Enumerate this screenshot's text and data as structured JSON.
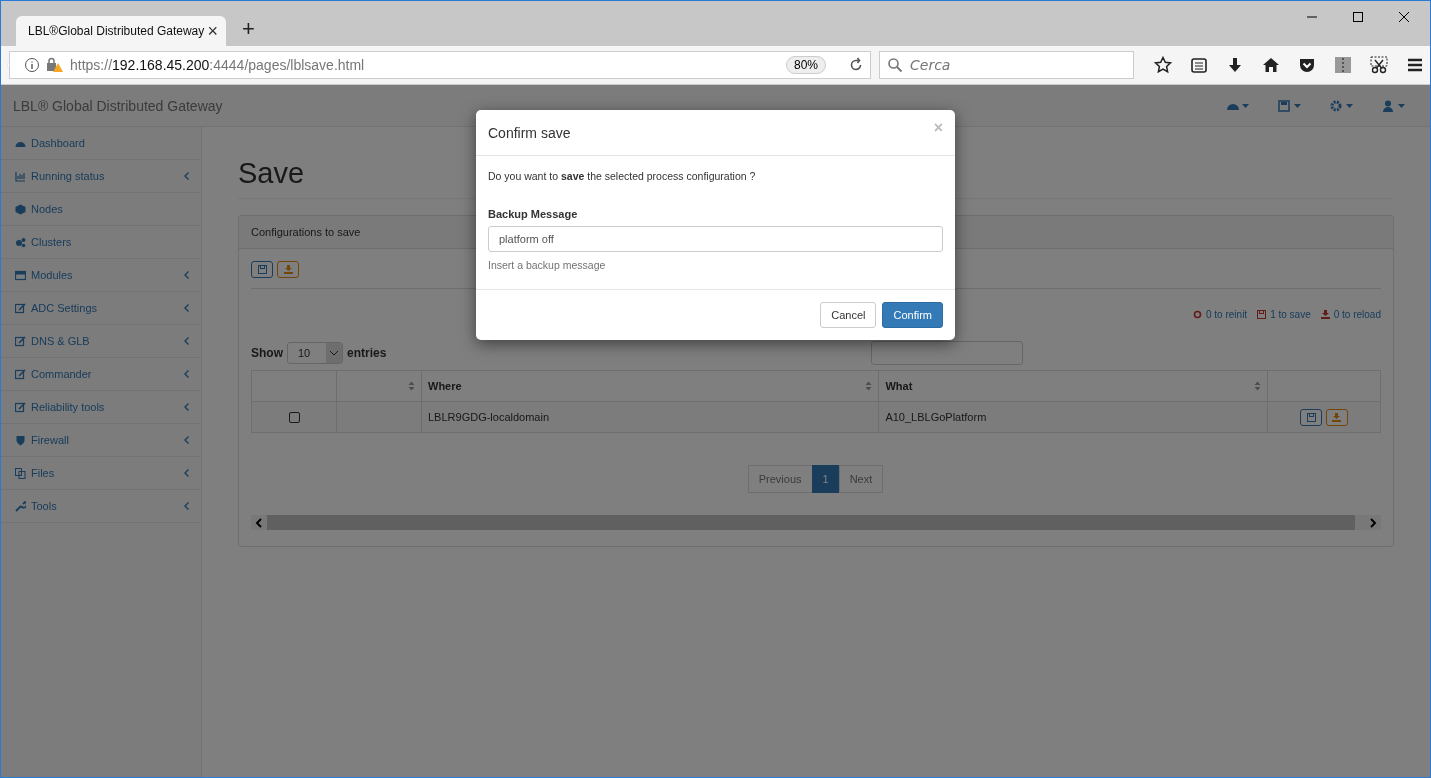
{
  "browser": {
    "tab": {
      "title": "LBL®Global Distributed Gateway",
      "close": "×",
      "new_tab": "+"
    },
    "address": {
      "scheme": "https://",
      "host": "192.168.45.200",
      "path": ":4444/pages/lblsave.html",
      "zoom": "80%"
    },
    "search": {
      "placeholder": "Cerca"
    }
  },
  "navbar": {
    "brand": "LBL® Global Distributed Gateway"
  },
  "sidebar": {
    "items": [
      {
        "label": "Dashboard",
        "has_submenu": false
      },
      {
        "label": "Running status",
        "has_submenu": true
      },
      {
        "label": "Nodes",
        "has_submenu": false
      },
      {
        "label": "Clusters",
        "has_submenu": false
      },
      {
        "label": "Modules",
        "has_submenu": true
      },
      {
        "label": "ADC Settings",
        "has_submenu": true
      },
      {
        "label": "DNS & GLB",
        "has_submenu": true
      },
      {
        "label": "Commander",
        "has_submenu": true
      },
      {
        "label": "Reliability tools",
        "has_submenu": true
      },
      {
        "label": "Firewall",
        "has_submenu": true
      },
      {
        "label": "Files",
        "has_submenu": true
      },
      {
        "label": "Tools",
        "has_submenu": true
      }
    ]
  },
  "page": {
    "title": "Save",
    "panel": {
      "heading": "Configurations to save",
      "counters": [
        {
          "kind": "reinit",
          "text": "0 to reinit"
        },
        {
          "kind": "save",
          "text": "1 to save"
        },
        {
          "kind": "reload",
          "text": "0 to reload"
        }
      ],
      "length": {
        "before": "Show",
        "value": "10",
        "after": "entries"
      },
      "table": {
        "columns": [
          "",
          "",
          "Where",
          "What",
          ""
        ],
        "rows": [
          {
            "checked": false,
            "where": "LBLR9GDG-localdomain",
            "what": "A10_LBLGoPlatform"
          }
        ]
      },
      "pagination": [
        {
          "label": "Previous",
          "selected": false
        },
        {
          "label": "1",
          "selected": true
        },
        {
          "label": "Next",
          "selected": false
        }
      ]
    }
  },
  "modal": {
    "title": "Confirm save",
    "close": "×",
    "message": "Do you want to **save** the selected process configuration ?",
    "field_label": "Backup Message",
    "field_value": "platform off",
    "help": "Insert a backup message",
    "buttons": [
      {
        "label": "Cancel",
        "kind": "default"
      },
      {
        "label": "Confirm",
        "kind": "primary"
      }
    ]
  }
}
